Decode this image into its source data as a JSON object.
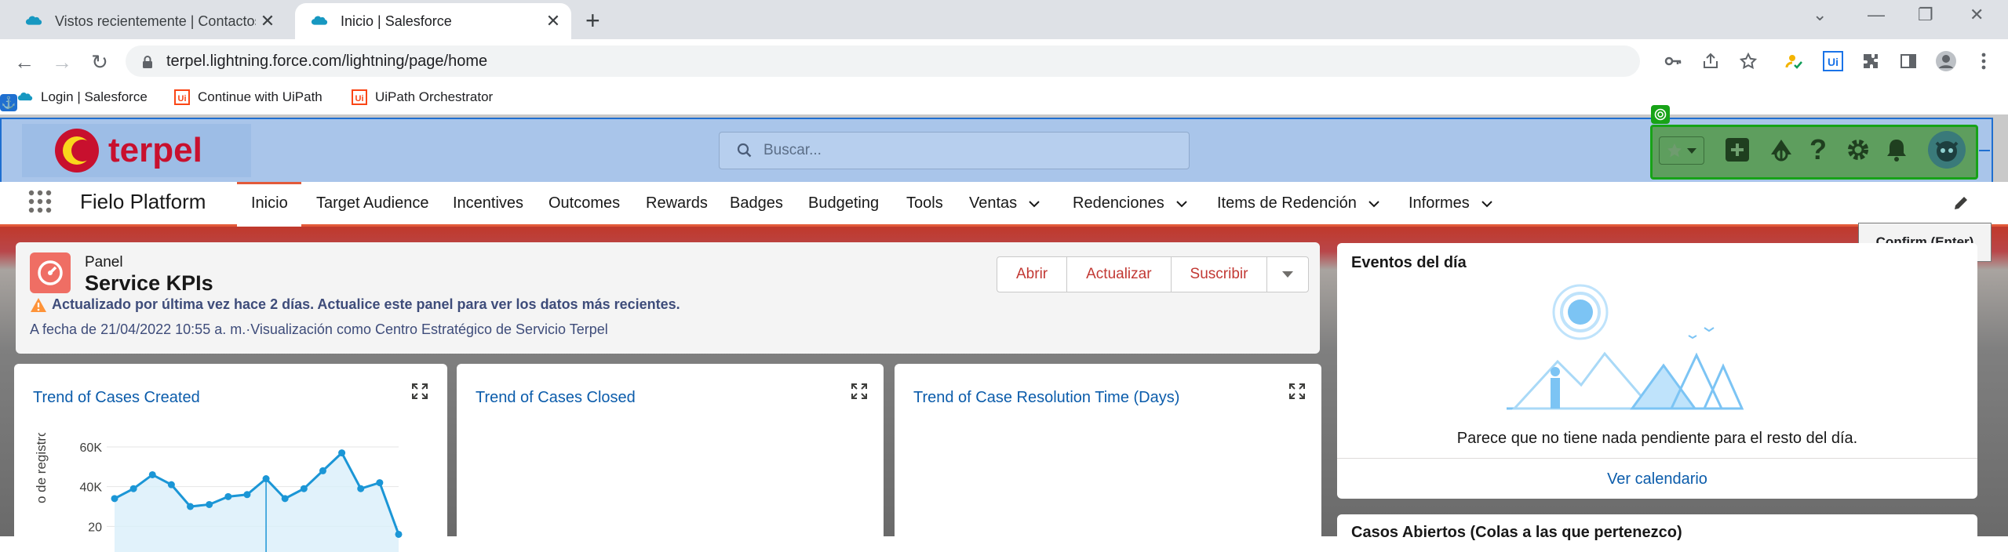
{
  "browser": {
    "tabs": [
      {
        "title": "Vistos recientemente | Contactos",
        "active": false
      },
      {
        "title": "Inicio | Salesforce",
        "active": true
      }
    ],
    "url": "terpel.lightning.force.com/lightning/page/home",
    "bookmarks": [
      "Login | Salesforce",
      "Continue with UiPath",
      "UiPath Orchestrator"
    ]
  },
  "header": {
    "logo_text": "terpel",
    "search_placeholder": "Buscar..."
  },
  "nav": {
    "app_name": "Fielo Platform",
    "items": [
      "Inicio",
      "Target Audience",
      "Incentives",
      "Outcomes",
      "Rewards",
      "Badges",
      "Budgeting",
      "Tools",
      "Ventas",
      "Redenciones",
      "Items de Redención",
      "Informes"
    ],
    "active_index": 0
  },
  "tooltip": "Confirm (Enter)",
  "panel": {
    "label": "Panel",
    "title": "Service KPIs",
    "warning": "Actualizado por última vez hace 2 días. Actualice este panel para ver los datos más recientes.",
    "as_of": "A fecha de 21/04/2022 10:55 a. m.·Visualización como Centro Estratégico de Servicio Terpel",
    "buttons": [
      "Abrir",
      "Actualizar",
      "Suscribir"
    ]
  },
  "cards": [
    {
      "title": "Trend of Cases Created"
    },
    {
      "title": "Trend of Cases Closed"
    },
    {
      "title": "Trend of Case Resolution Time (Days)"
    }
  ],
  "chart_data": {
    "type": "area",
    "ylabel": "o de registros",
    "y_ticks": [
      "60K",
      "40K",
      "20"
    ],
    "ylim": [
      0,
      60000
    ],
    "values": [
      34000,
      39000,
      46000,
      41000,
      30000,
      31000,
      35000,
      36000,
      44000,
      34000,
      39000,
      48000,
      57000,
      39000,
      42000,
      16000
    ],
    "color": "#1b96d6"
  },
  "events": {
    "title": "Eventos del día",
    "message": "Parece que no tiene nada pendiente para el resto del día.",
    "link": "Ver calendario"
  },
  "open_cases": {
    "title": "Casos Abiertos (Colas a las que pertenezco)"
  }
}
